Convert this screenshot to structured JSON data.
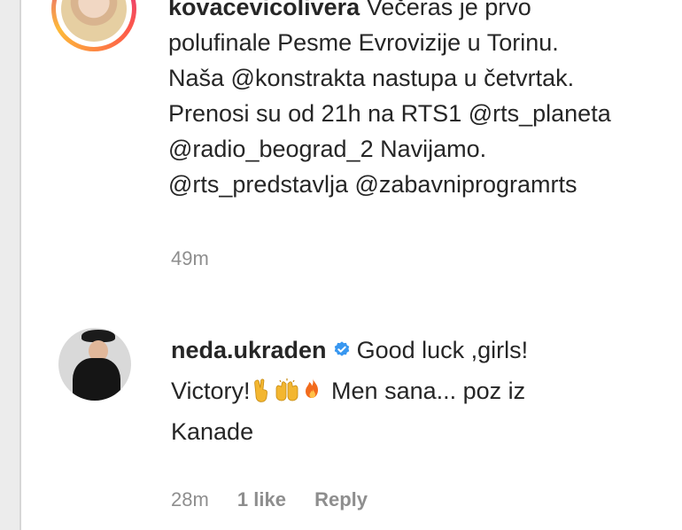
{
  "caption": {
    "username": "kovacevicolivera",
    "lines": [
      "Večeras je prvo",
      "polufinale Pesme Evrovizije u Torinu.",
      "Naša @konstrakta nastupa u četvrtak.",
      "Prenosi su od 21h na RTS1 @rts_planeta",
      "@radio_beograd_2 Navijamo.",
      "@rts_predstavlja @zabavniprogramrts"
    ],
    "time": "49m"
  },
  "comment": {
    "username": "neda.ukraden",
    "verified": true,
    "text_line1": "Good luck ,girls!",
    "text_line2_start": "Victory!",
    "text_line2_end": "Men sana... poz iz",
    "text_line3": "Kanade",
    "emojis": [
      "victory-hand-icon",
      "raising-hands-icon",
      "fire-icon"
    ],
    "time": "28m",
    "likes": "1 like",
    "reply_label": "Reply"
  },
  "colors": {
    "text": "#262626",
    "muted": "#8e8e8e",
    "verified_badge": "#3897f0",
    "emoji_skin": "#f3b630",
    "fire": "#f26b1d"
  }
}
